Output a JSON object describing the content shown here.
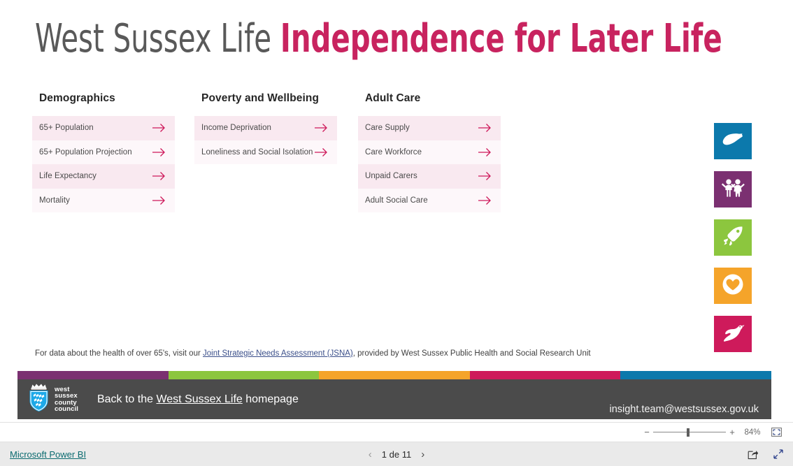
{
  "report": {
    "title_part1": "West Sussex Life ",
    "title_part2": "Independence for Later Life",
    "title_color_1": "#595959",
    "title_color_2": "#C8235F"
  },
  "columns": [
    {
      "heading": "Demographics",
      "items": [
        {
          "label": "65+ Population",
          "arrow_icon": "arrow-right-icon"
        },
        {
          "label": "65+ Population Projection",
          "arrow_icon": "arrow-right-icon"
        },
        {
          "label": "Life Expectancy",
          "arrow_icon": "arrow-right-icon"
        },
        {
          "label": "Mortality",
          "arrow_icon": "arrow-right-icon"
        }
      ]
    },
    {
      "heading": "Poverty and Wellbeing",
      "items": [
        {
          "label": "Income Deprivation",
          "arrow_icon": "arrow-right-icon"
        },
        {
          "label": "Loneliness and Social Isolation",
          "arrow_icon": "arrow-right-icon"
        }
      ]
    },
    {
      "heading": "Adult Care",
      "items": [
        {
          "label": "Care Supply",
          "arrow_icon": "arrow-right-icon"
        },
        {
          "label": "Care Workforce",
          "arrow_icon": "arrow-right-icon"
        },
        {
          "label": "Unpaid Carers",
          "arrow_icon": "arrow-right-icon"
        },
        {
          "label": "Adult Social Care",
          "arrow_icon": "arrow-right-icon"
        }
      ]
    }
  ],
  "brand_tiles": [
    {
      "icon": "map-outline-icon",
      "color": "#0C79AC"
    },
    {
      "icon": "two-people-icon",
      "color": "#7B3071"
    },
    {
      "icon": "rocket-icon",
      "color": "#8CC63E"
    },
    {
      "icon": "heart-circle-icon",
      "color": "#F5A42A"
    },
    {
      "icon": "dove-bird-icon",
      "color": "#CE1A5B"
    }
  ],
  "data_note": {
    "before": "For data about the health of over 65's, visit our ",
    "link": "Joint Strategic Needs Assessment (JSNA)",
    "after": ", provided by West Sussex Public Health and Social Research Unit"
  },
  "colour_stripe": [
    "#7B3071",
    "#8CC63E",
    "#F5A42A",
    "#CE1A5B",
    "#0C79AC"
  ],
  "footer": {
    "logo_lines": [
      "west",
      "sussex",
      "county",
      "council"
    ],
    "home_before": "Back to the ",
    "home_link": "West Sussex Life",
    "home_after": " homepage",
    "email": "insight.team@westsussex.gov.uk",
    "background": "#4b4b4b"
  },
  "chrome": {
    "zoom_minus": "−",
    "zoom_plus": "+",
    "zoom_level": "84%",
    "fit_icon": "fit-to-page-icon",
    "brand_link": "Microsoft Power BI",
    "prev_icon": "chevron-left-icon",
    "next_icon": "chevron-right-icon",
    "page_label": "1 de 11",
    "share_icon": "share-icon",
    "fullscreen_icon": "fullscreen-icon"
  }
}
